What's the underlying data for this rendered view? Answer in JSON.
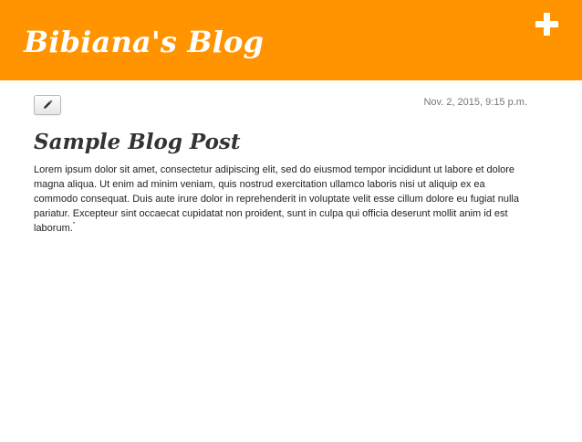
{
  "header": {
    "site_title": "Bibiana's Blog",
    "add_icon": "plus-icon",
    "background_color": "#ff9400"
  },
  "post": {
    "edit_icon": "pencil-icon",
    "date": "Nov. 2, 2015, 9:15 p.m.",
    "title": "Sample Blog Post",
    "body": "Lorem ipsum dolor sit amet, consectetur adipiscing elit, sed do eiusmod tempor incididunt ut labore et dolore magna aliqua. Ut enim ad minim veniam, quis nostrud exercitation ullamco laboris nisi ut aliquip ex ea commodo consequat. Duis aute irure dolor in reprehenderit in voluptate velit esse cillum dolore eu fugiat nulla pariatur. Excepteur sint occaecat cupidatat non proident, sunt in culpa qui officia deserunt mollit anim id est laborum.",
    "trailing_mark": "\""
  }
}
